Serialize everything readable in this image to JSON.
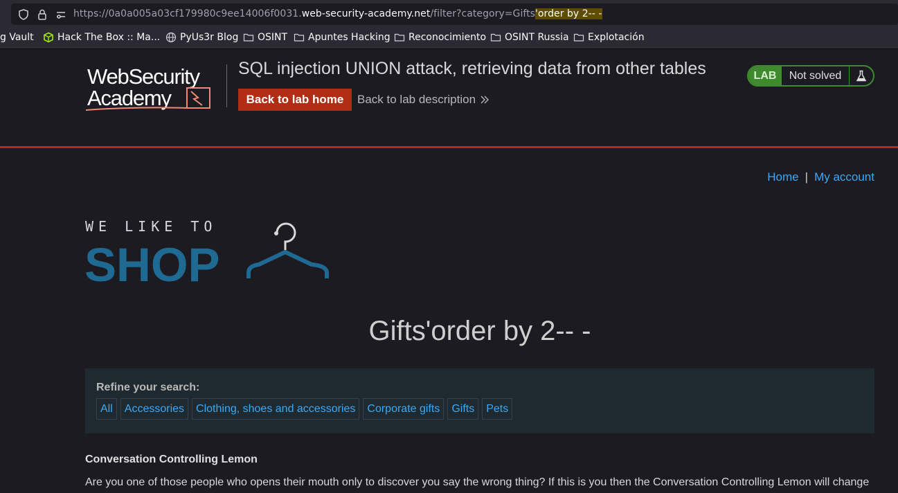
{
  "browser": {
    "url_prefix": "https://0a0a005a03cf179980c9ee14006f0031.",
    "url_host": "web-security-academy.net",
    "url_path": "/filter?category=Gifts",
    "url_highlight": "'order by 2-- -",
    "bookmarks": [
      {
        "label": "g Vault",
        "icon": "none"
      },
      {
        "label": "Hack The Box :: Ma...",
        "icon": "htb-cube-icon"
      },
      {
        "label": "PyUs3r Blog",
        "icon": "globe-icon"
      },
      {
        "label": "OSINT",
        "icon": "folder-icon"
      },
      {
        "label": "Apuntes Hacking",
        "icon": "folder-icon"
      },
      {
        "label": "Reconocimiento",
        "icon": "folder-icon"
      },
      {
        "label": "OSINT Russia",
        "icon": "folder-icon"
      },
      {
        "label": "Explotación",
        "icon": "folder-icon"
      }
    ]
  },
  "academy": {
    "logo_line1": "WebSecurity",
    "logo_line2": "Academy",
    "lab_title": "SQL injection UNION attack, retrieving data from other tables",
    "back_home": "Back to lab home",
    "back_desc": "Back to lab description",
    "status_tag": "LAB",
    "status_text": "Not solved",
    "colors": {
      "accent": "#b12e14",
      "status_green": "#3f8a2e"
    }
  },
  "shop": {
    "nav_home": "Home",
    "nav_sep": "|",
    "nav_account": "My account",
    "logo_small": "WE LIKE TO",
    "logo_big": "SHOP",
    "category_title": "Gifts'order by 2-- -",
    "refine_label": "Refine your search:",
    "categories": [
      "All",
      "Accessories",
      "Clothing, shoes and accessories",
      "Corporate gifts",
      "Gifts",
      "Pets"
    ],
    "product_name": "Conversation Controlling Lemon",
    "product_desc": "Are you one of those people who opens their mouth only to discover you say the wrong thing? If this is you then the Conversation Controlling Lemon will change"
  }
}
